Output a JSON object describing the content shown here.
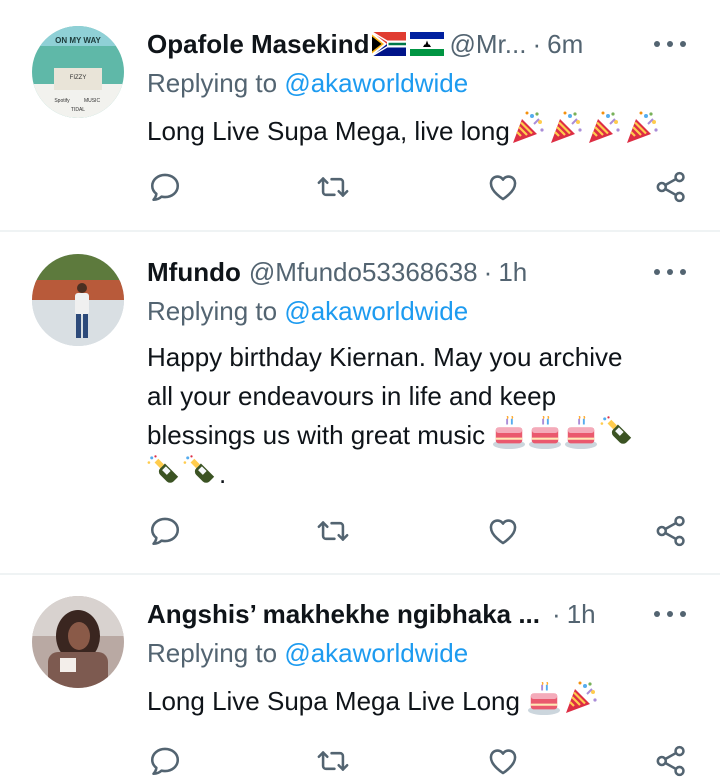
{
  "tweets": [
    {
      "name": "Opafole Masekind",
      "handle": "@Mr...",
      "sep": "·",
      "time": "6m",
      "reply_prefix": "Replying to",
      "reply_to": "@akaworldwide",
      "text": "Long Live Supa Mega, live long",
      "emojis": [
        "party-popper",
        "party-popper",
        "party-popper",
        "party-popper"
      ],
      "flags": [
        "south-africa-flag",
        "lesotho-flag"
      ],
      "avatar_text": {
        "top": "ON MY WAY",
        "mid": "FIZZY",
        "b1": "Spotify",
        "b2": "MUSIC",
        "b3": "TIDAL"
      }
    },
    {
      "name": "Mfundo",
      "handle": "@Mfundo53368638",
      "sep": "·",
      "time": "1h",
      "reply_prefix": "Replying to",
      "reply_to": "@akaworldwide",
      "line1": "Happy birthday Kiernan. May you archive",
      "line2": "all your endeavours in life and keep",
      "line3": "blessings us with great music",
      "line4_end": "."
    },
    {
      "name": "Angshis’ makhekhe ngibhaka ...",
      "sep": "·",
      "time": "1h",
      "reply_prefix": "Replying to",
      "reply_to": "@akaworldwide",
      "text": "Long Live Supa Mega Live Long"
    }
  ],
  "icons": [
    "reply-icon",
    "retweet-icon",
    "like-icon",
    "share-icon",
    "more-icon"
  ],
  "colors": {
    "text": "#0f1419",
    "secondary": "#536471",
    "link": "#1d9bf0",
    "divider": "#eff3f4"
  }
}
